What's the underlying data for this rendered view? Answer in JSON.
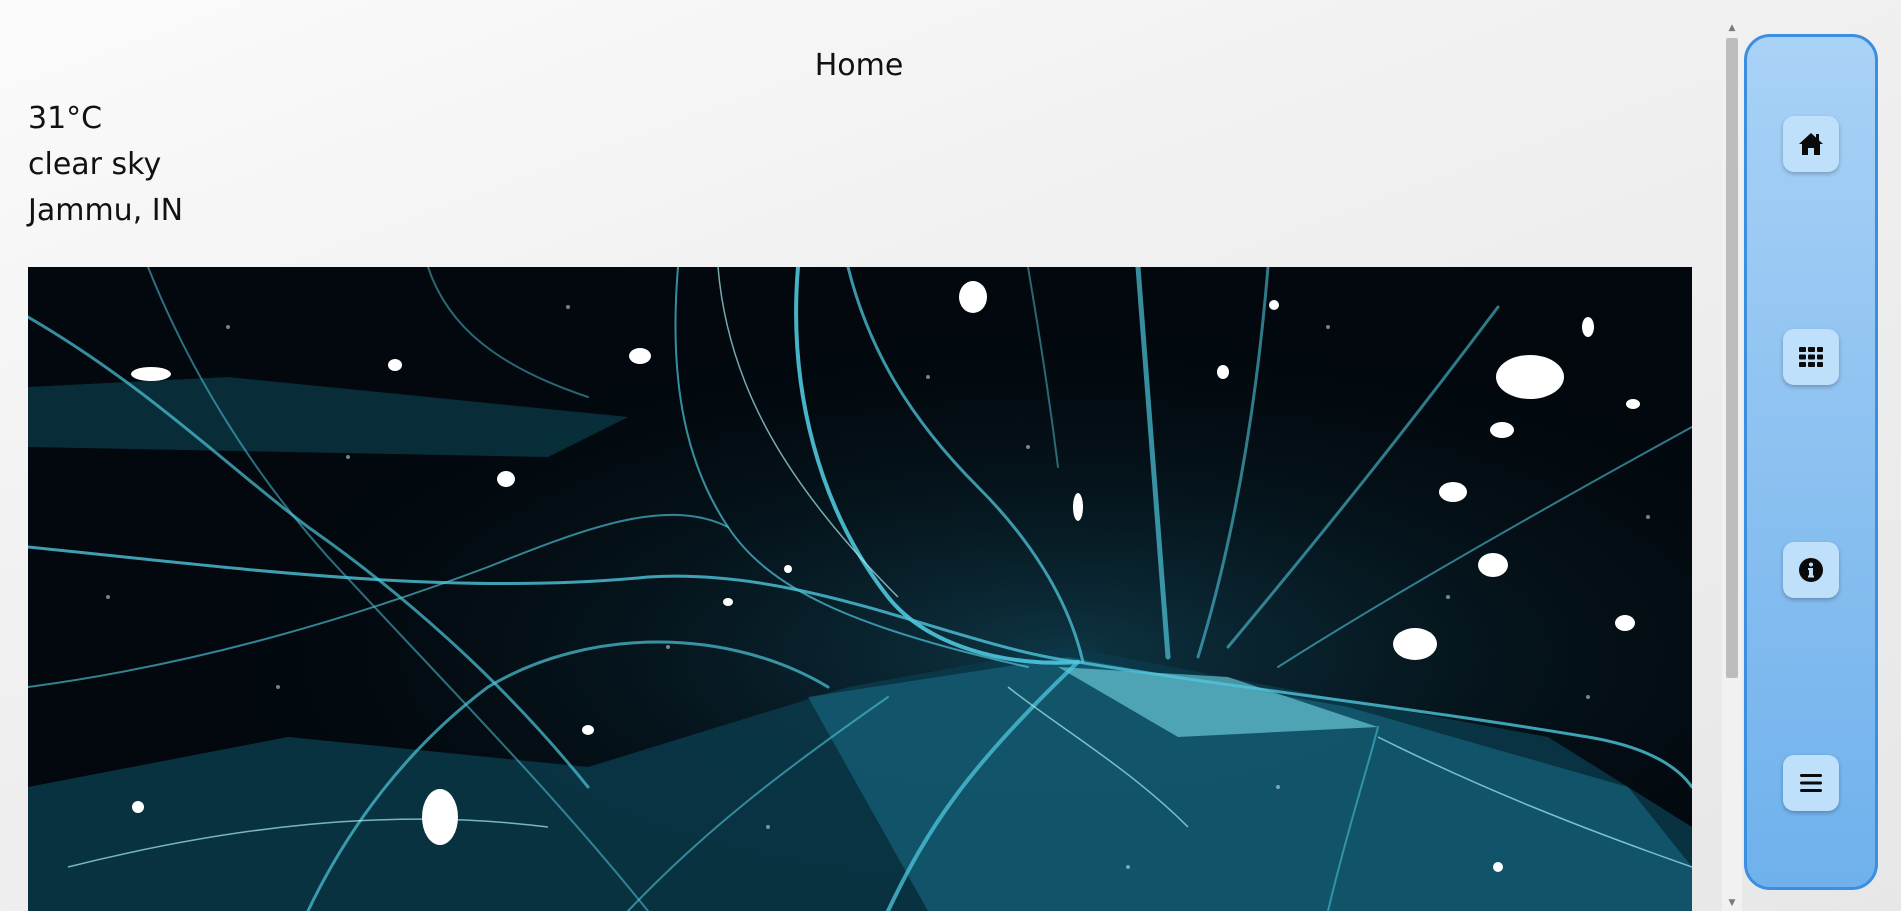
{
  "page": {
    "title": "Home"
  },
  "weather": {
    "temperature": "31°C",
    "description": "clear sky",
    "location": "Jammu, IN"
  },
  "hero_image": {
    "subject": "ice cracks photograph"
  },
  "side_nav": {
    "buttons": [
      {
        "name": "home",
        "icon": "home-icon"
      },
      {
        "name": "apps",
        "icon": "grid-icon"
      },
      {
        "name": "about",
        "icon": "info-icon"
      },
      {
        "name": "menu",
        "icon": "menu-icon"
      }
    ],
    "colors": {
      "panel": "#8cc1f1",
      "border": "#3b8fe0",
      "button": "#bfe0fb"
    }
  }
}
